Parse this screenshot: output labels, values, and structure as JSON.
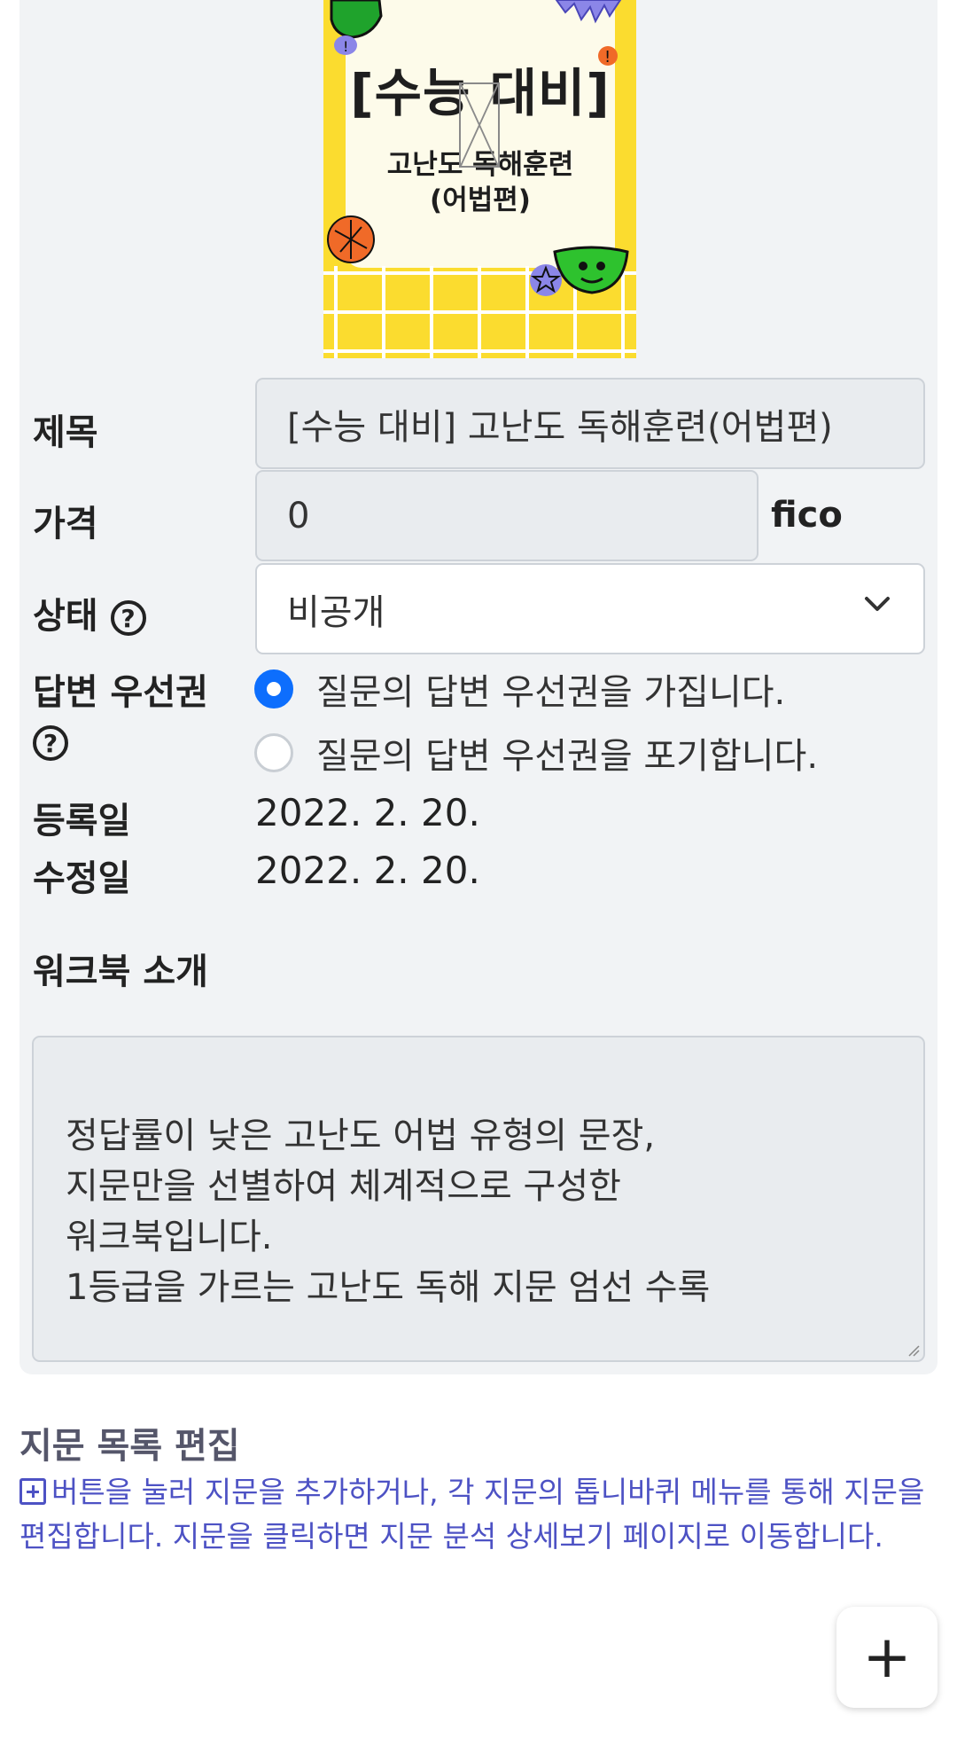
{
  "cover": {
    "title": "[수능 대비]",
    "subtitle_line1": "고난도 독해훈련",
    "subtitle_line2": "(어법편)"
  },
  "form": {
    "title_label": "제목",
    "title_value": "[수능 대비] 고난도 독해훈련(어법편)",
    "price_label": "가격",
    "price_value": "0",
    "price_unit": "fico",
    "status_label": "상태",
    "status_value": "비공개",
    "priority_label": "답변 우선권",
    "priority_options": [
      {
        "label": "질문의 답변 우선권을 가집니다.",
        "selected": true
      },
      {
        "label": "질문의 답변 우선권을 포기합니다.",
        "selected": false
      }
    ],
    "registered_label": "등록일",
    "registered_value": "2022. 2. 20.",
    "modified_label": "수정일",
    "modified_value": "2022. 2. 20.",
    "intro_label": "워크북 소개",
    "intro_value": "정답률이 낮은 고난도 어법 유형의 문장,\n지문만을 선별하여 체계적으로 구성한\n워크북입니다.\n1등급을 가르는 고난도 독해 지문 엄선 수록"
  },
  "edit_section": {
    "title": "지문 목록 편집",
    "description": "버튼을 눌러 지문을 추가하거나, 각 지문의 톱니바퀴 메뉴를 통해 지문을 편집합니다. 지문을 클릭하면 지문 분석 상세보기 페이지로 이동합니다.",
    "add_button_label": "+"
  },
  "colors": {
    "accent": "#0d6efd",
    "link": "#4d52c4",
    "cover_yellow": "#fbdc2f"
  }
}
